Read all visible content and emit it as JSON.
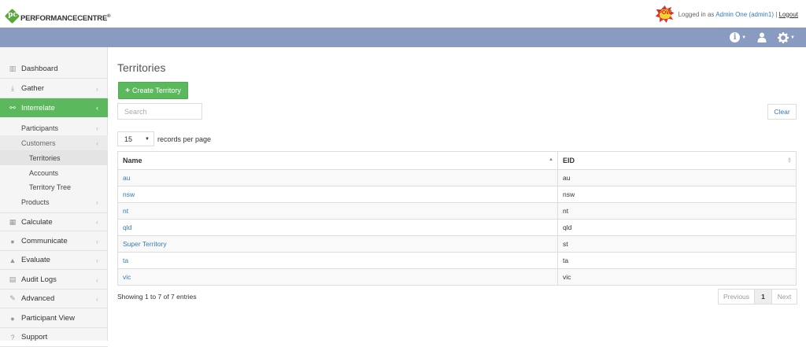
{
  "brand": {
    "logo_letters": "pc",
    "name": "PERFORMANCECENTRE",
    "reg": "®"
  },
  "user": {
    "avatar_text": "POW",
    "prefix": "Logged in as ",
    "name": "Admin One (admin1)",
    "separator": " | ",
    "logout": "Logout"
  },
  "topnav": {
    "icons": [
      "info-icon",
      "user-icon",
      "gear-icon"
    ]
  },
  "sidebar": {
    "dashboard": "Dashboard",
    "gather": "Gather",
    "interrelate": "Interrelate",
    "participants": "Participants",
    "customers": "Customers",
    "territories": "Territories",
    "accounts": "Accounts",
    "territory_tree": "Territory Tree",
    "products": "Products",
    "calculate": "Calculate",
    "communicate": "Communicate",
    "evaluate": "Evaluate",
    "audit_logs": "Audit Logs",
    "advanced": "Advanced",
    "participant_view": "Participant View",
    "support": "Support"
  },
  "main": {
    "title": "Territories",
    "create_label": "Create Territory",
    "search_placeholder": "Search",
    "clear_label": "Clear",
    "per_page_value": "15",
    "per_page_label": "records per page",
    "columns": {
      "name": "Name",
      "eid": "EID"
    },
    "rows": [
      {
        "name": "au",
        "eid": "au"
      },
      {
        "name": "nsw",
        "eid": "nsw"
      },
      {
        "name": "nt",
        "eid": "nt"
      },
      {
        "name": "qld",
        "eid": "qld"
      },
      {
        "name": "Super Territory",
        "eid": "st"
      },
      {
        "name": "ta",
        "eid": "ta"
      },
      {
        "name": "vic",
        "eid": "vic"
      }
    ],
    "showing": "Showing 1 to 7 of 7 entries",
    "pager": {
      "prev": "Previous",
      "page": "1",
      "next": "Next"
    }
  },
  "colors": {
    "accent_green": "#5cb85c",
    "header_bar": "#8a9bc2",
    "link": "#337ab7"
  }
}
